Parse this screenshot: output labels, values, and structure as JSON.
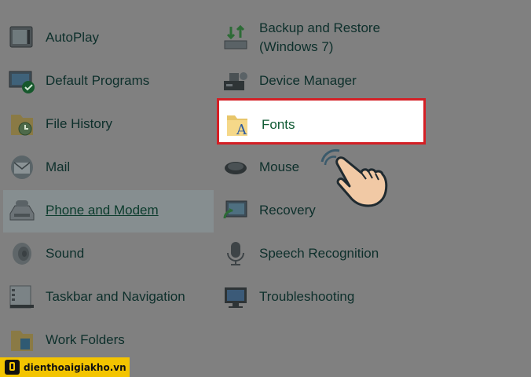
{
  "left_column": [
    {
      "label": "AutoPlay",
      "icon": "autoplay-icon"
    },
    {
      "label": "Default Programs",
      "icon": "default-programs-icon"
    },
    {
      "label": "File History",
      "icon": "file-history-icon"
    },
    {
      "label": "Mail",
      "icon": "mail-icon"
    },
    {
      "label": "Phone and Modem",
      "icon": "phone-modem-icon"
    },
    {
      "label": "Sound",
      "icon": "speaker-icon"
    },
    {
      "label": "Taskbar and Navigation",
      "icon": "taskbar-icon"
    },
    {
      "label": "Work Folders",
      "icon": "work-folders-icon"
    }
  ],
  "right_column": [
    {
      "label_line1": "Backup and Restore",
      "label_line2": "(Windows 7)",
      "icon": "backup-restore-icon"
    },
    {
      "label": "Device Manager",
      "icon": "device-manager-icon"
    },
    {
      "label": "Fonts",
      "icon": "fonts-folder-icon"
    },
    {
      "label": "Mouse",
      "icon": "mouse-icon"
    },
    {
      "label": "Recovery",
      "icon": "recovery-icon"
    },
    {
      "label": "Speech Recognition",
      "icon": "microphone-icon"
    },
    {
      "label": "Troubleshooting",
      "icon": "troubleshooting-icon"
    }
  ],
  "highlight": {
    "item": "Fonts",
    "border_color": "#d41f25"
  },
  "hovered_item": "Phone and Modem",
  "pointer": {
    "icon": "hand-pointer-icon"
  },
  "watermark": {
    "text": "dienthoaigiakho.vn",
    "background": "#f3c400"
  }
}
